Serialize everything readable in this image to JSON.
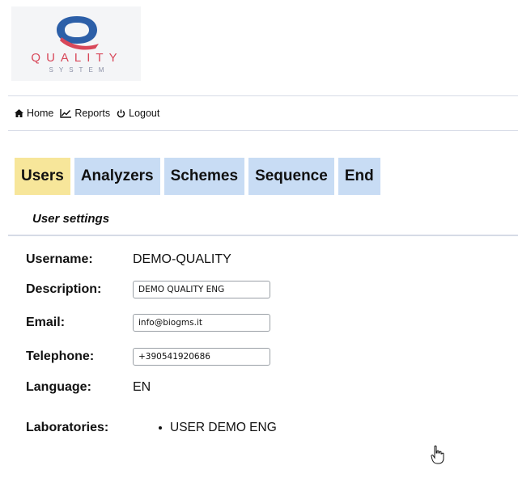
{
  "logo": {
    "word": "QUALITY",
    "sub": "SYSTEM"
  },
  "nav": {
    "home": {
      "label": "Home",
      "icon": "home-icon"
    },
    "reports": {
      "label": "Reports",
      "icon": "chart-icon"
    },
    "logout": {
      "label": "Logout",
      "icon": "power-icon"
    }
  },
  "tabs": [
    {
      "label": "Users",
      "active": true
    },
    {
      "label": "Analyzers",
      "active": false
    },
    {
      "label": "Schemes",
      "active": false
    },
    {
      "label": "Sequence",
      "active": false
    },
    {
      "label": "End",
      "active": false
    }
  ],
  "subtitle": "User settings",
  "form": {
    "username_label": "Username:",
    "username_value": "DEMO-QUALITY",
    "description_label": "Description:",
    "description_value": "DEMO QUALITY ENG",
    "email_label": "Email:",
    "email_value": "info@biogms.it",
    "telephone_label": "Telephone:",
    "telephone_value": "+390541920686",
    "language_label": "Language:",
    "language_value": "EN",
    "laboratories_label": "Laboratories:",
    "laboratories": [
      "USER DEMO ENG"
    ]
  },
  "colors": {
    "active_tab": "#f7e69a",
    "tab": "#c8dcf4",
    "logo_blue": "#2c5fa8",
    "logo_red": "#d8485a"
  }
}
